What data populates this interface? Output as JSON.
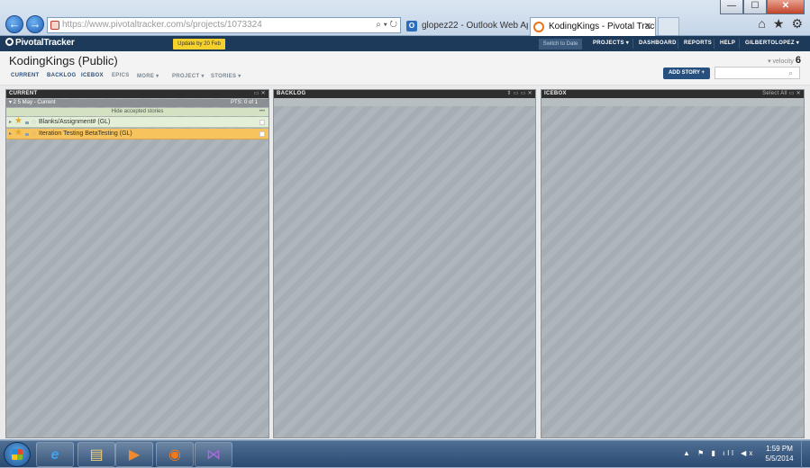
{
  "browser": {
    "url": "https://www.pivotaltracker.com/s/projects/1073324",
    "addr_tools": "⌕ ▾ ↻",
    "tabs": [
      {
        "label": "glopez22 - Outlook Web App",
        "icon": "outlook-icon"
      },
      {
        "label": "KodingKings - Pivotal Tracker",
        "icon": "pivotal-icon"
      }
    ],
    "tab_close": "✕",
    "window_buttons": {
      "minimize": "—",
      "maximize": "☐",
      "close": "✕"
    },
    "tools": [
      "⌂",
      "★",
      "⚙"
    ]
  },
  "header": {
    "logo": "PivotalTracker",
    "update_badge": "Update by 20 Feb",
    "switch_date": "Switch to Date",
    "nav": [
      "PROJECTS ▾",
      "DASHBOARD",
      "REPORTS",
      "HELP",
      "GILBERTOLOPEZ ▾"
    ]
  },
  "project": {
    "title": "KodingKings (Public)",
    "velocity_label": "▾ velocity",
    "velocity_value": "6",
    "tabs": [
      "CURRENT",
      "BACKLOG",
      "ICEBOX",
      "EPICS",
      "MORE ▾",
      "PROJECT ▾",
      "STORIES ▾"
    ],
    "add_story": "ADD STORY +",
    "search_placeholder": ""
  },
  "panels": {
    "current": {
      "title": "CURRENT",
      "tools": "▭ ✕",
      "iteration": "▾  2   5 May - Current",
      "iteration_points": "PTS: 0 of 1",
      "hide_accepted": "Hide accepted stories",
      "accepted_dots": "•••",
      "stories": [
        {
          "title": "Blanks/Assignment# (GL)"
        },
        {
          "title": "Iteration Testing BetaTesting (GL)"
        }
      ]
    },
    "backlog": {
      "title": "BACKLOG",
      "tools": "⇕ ▭ ▭ ✕"
    },
    "icebox": {
      "title": "ICEBOX",
      "tools": "Select All  ▭ ✕"
    }
  },
  "taskbar": {
    "apps": [
      {
        "name": "internet-explorer",
        "glyph": "e"
      },
      {
        "name": "file-explorer",
        "glyph": "▤"
      },
      {
        "name": "media-player",
        "glyph": "▶"
      },
      {
        "name": "firefox",
        "glyph": "◉"
      },
      {
        "name": "visual-studio",
        "glyph": "⋈"
      }
    ],
    "tray": "▲ ⚑ ▮ ıll ◀x",
    "time": "1:59 PM",
    "date": "5/5/2014"
  }
}
